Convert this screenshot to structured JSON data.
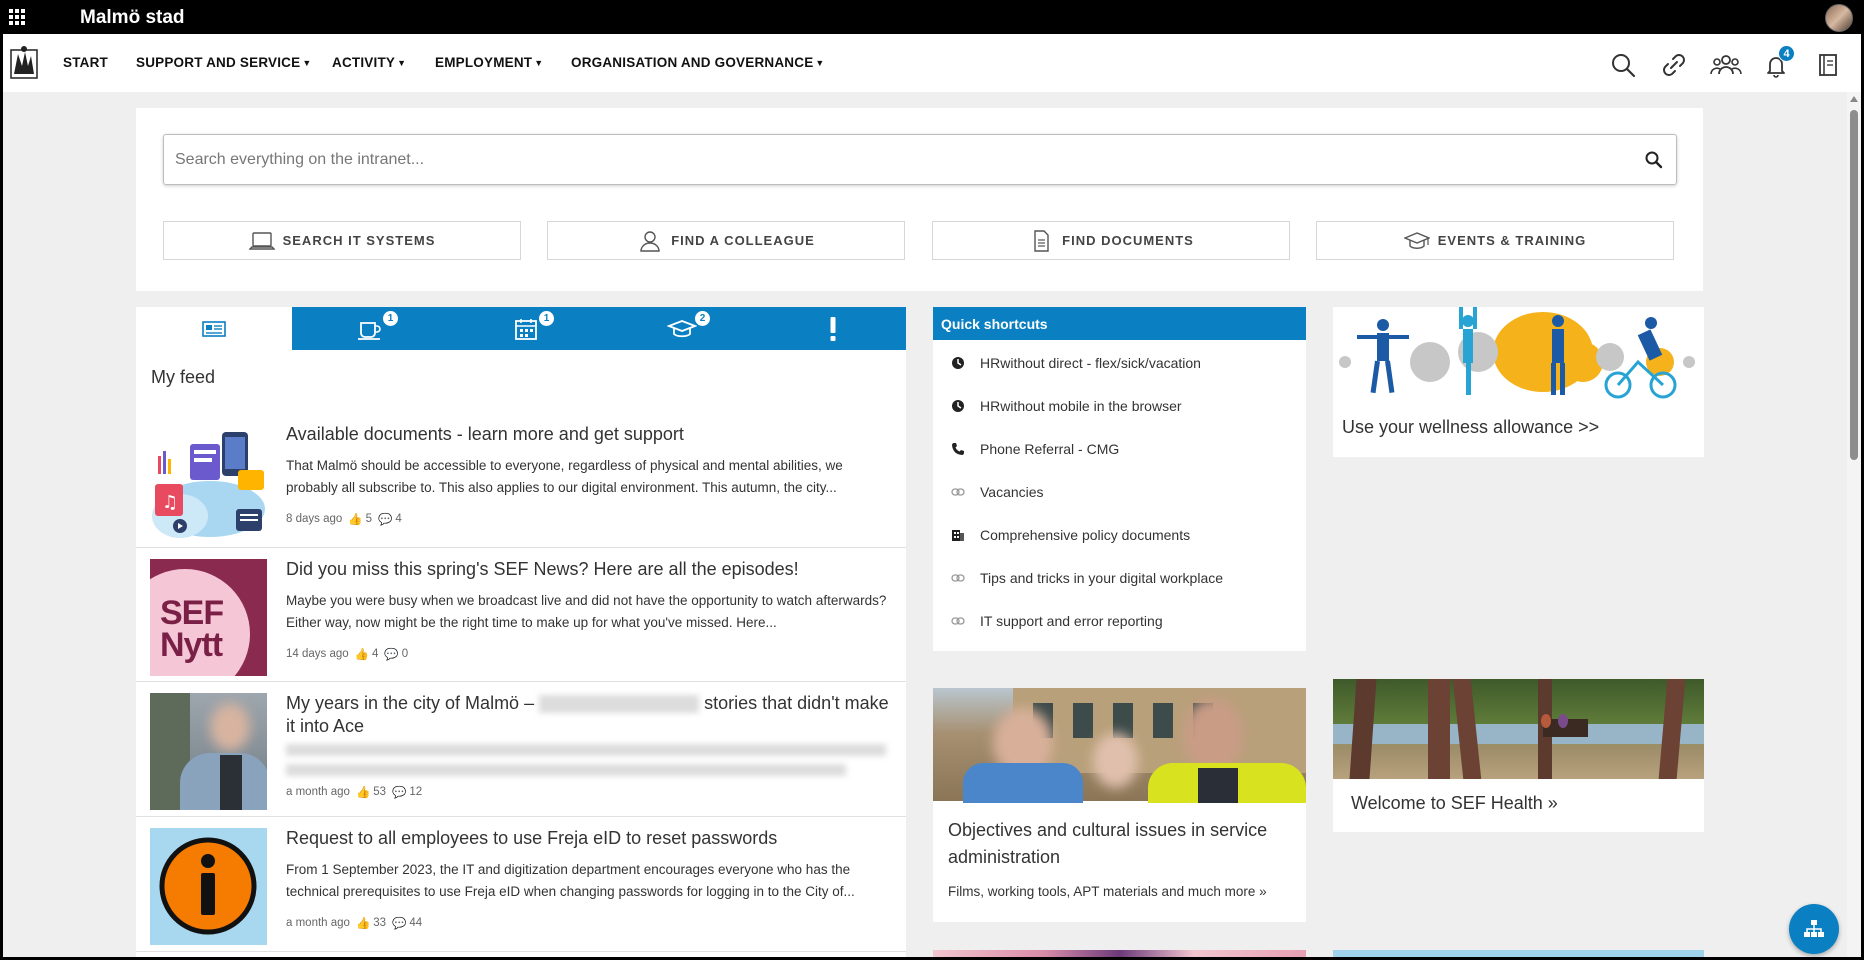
{
  "topbar": {
    "brand": "Malmö stad"
  },
  "nav": {
    "items": [
      {
        "label": "START"
      },
      {
        "label": "SUPPORT AND SERVICE"
      },
      {
        "label": "ACTIVITY"
      },
      {
        "label": "EMPLOYMENT"
      },
      {
        "label": "ORGANISATION AND GOVERNANCE"
      }
    ],
    "notifications_count": "4",
    "icons": [
      "search-icon",
      "link-icon",
      "people-icon",
      "bell-icon",
      "notebook-icon"
    ]
  },
  "search": {
    "placeholder": "Search everything on the intranet..."
  },
  "quick_buttons": [
    {
      "label": "SEARCH IT SYSTEMS",
      "icon": "laptop-icon"
    },
    {
      "label": "FIND A COLLEAGUE",
      "icon": "person-icon"
    },
    {
      "label": "FIND DOCUMENTS",
      "icon": "document-icon"
    },
    {
      "label": "EVENTS & TRAINING",
      "icon": "graduation-cap-icon"
    }
  ],
  "feed_tabs": [
    {
      "icon": "newspaper-icon",
      "badge": ""
    },
    {
      "icon": "coffee-icon",
      "badge": "1"
    },
    {
      "icon": "calendar-icon",
      "badge": "1"
    },
    {
      "icon": "graduation-cap-icon",
      "badge": "2"
    },
    {
      "icon": "exclamation-icon",
      "badge": ""
    }
  ],
  "feed": {
    "title": "My feed",
    "items": [
      {
        "title": "Available documents - learn more and get support",
        "body": "That Malmö should be accessible to everyone, regardless of physical and mental abilities, we probably all subscribe to. This also applies to our digital environment. This autumn, the city...",
        "age": "8 days ago",
        "likes": "5",
        "comments": "4"
      },
      {
        "title": "Did you miss this spring's SEF News? Here are all the episodes!",
        "body": "Maybe you were busy when we broadcast live and did not have the opportunity to watch afterwards? Either way, now might be the right time to make up for what you've missed. Here...",
        "age": "14 days ago",
        "likes": "4",
        "comments": "0",
        "thumb_line1": "SEF",
        "thumb_line2": "Nytt"
      },
      {
        "title_start": "My years in the city of Malmö –",
        "title_end": "stories that didn't make it into Ace",
        "age": "a month ago",
        "likes": "53",
        "comments": "12"
      },
      {
        "title": "Request to all employees to use Freja eID to reset passwords",
        "body": "From 1 September 2023, the IT and digitization department encourages everyone who has the technical prerequisites to use Freja eID when changing passwords for logging in to the City of...",
        "age": "a month ago",
        "likes": "33",
        "comments": "44"
      }
    ]
  },
  "shortcuts": {
    "title": "Quick shortcuts",
    "items": [
      {
        "label": "HRwithout direct - flex/sick/vacation",
        "icon": "clock-icon"
      },
      {
        "label": "HRwithout mobile in the browser",
        "icon": "clock-icon"
      },
      {
        "label": "Phone Referral - CMG",
        "icon": "phone-icon"
      },
      {
        "label": "Vacancies",
        "icon": "link-icon"
      },
      {
        "label": "Comprehensive policy documents",
        "icon": "building-icon"
      },
      {
        "label": "Tips and tricks in your digital workplace",
        "icon": "link-icon"
      },
      {
        "label": "IT support and error reporting",
        "icon": "link-icon"
      }
    ]
  },
  "cards": {
    "wellness": {
      "title": "Use your wellness allowance >>"
    },
    "objectives": {
      "title": "Objectives and cultural issues in service administration",
      "subtitle": "Films, working tools, APT materials and much more »"
    },
    "health": {
      "title": "Welcome to SEF Health »"
    }
  },
  "colors": {
    "accent": "#0a7fc2",
    "topbar": "#000000",
    "background": "#efefef"
  }
}
